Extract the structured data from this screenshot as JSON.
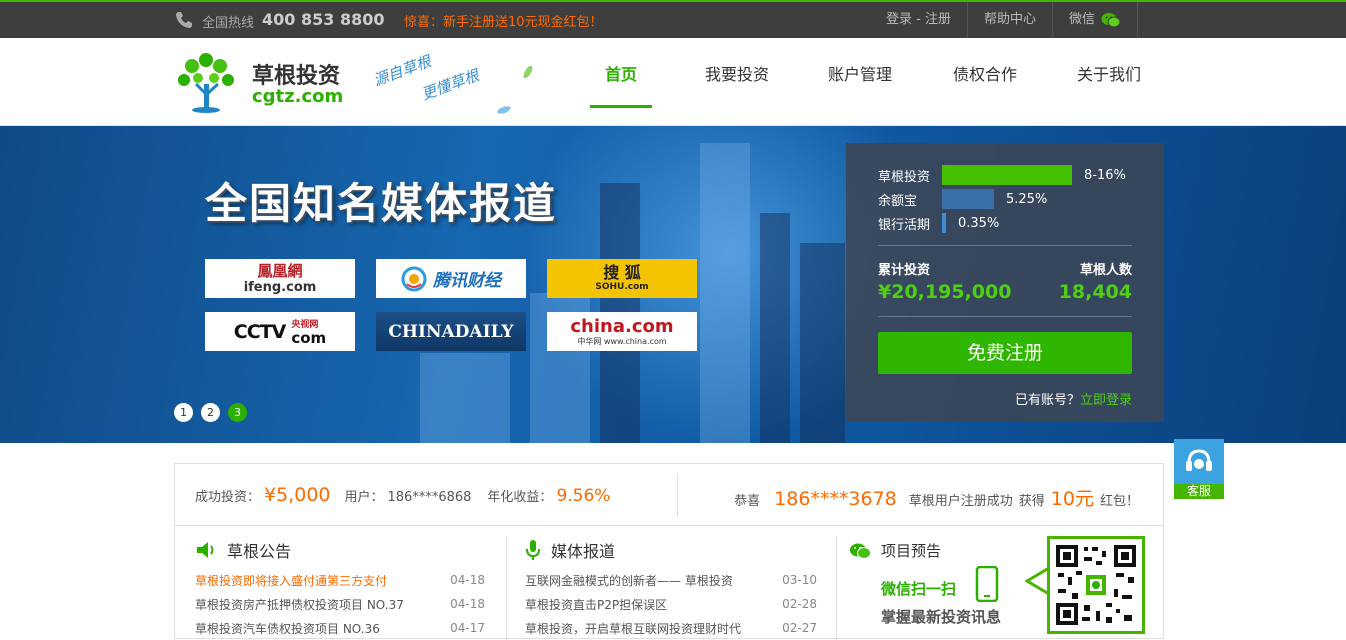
{
  "topbar": {
    "hotline_label": "全国热线",
    "hotline_number": "400 853 8800",
    "promo": "惊喜：新手注册送10元现金红包！",
    "login_register": "登录 - 注册",
    "help": "帮助中心",
    "wechat": "微信"
  },
  "header": {
    "logo_name": "草根投资",
    "logo_domain": "cgtz.com",
    "slogan_1": "源自草根",
    "slogan_2": "更懂草根",
    "nav": [
      "首页",
      "我要投资",
      "账户管理",
      "债权合作",
      "关于我们"
    ],
    "active_nav": "首页"
  },
  "banner": {
    "title": "全国知名媒体报道",
    "media": {
      "ifeng_cn": "鳳凰網",
      "ifeng_en": "ifeng.com",
      "tencent": "腾讯财经",
      "sohu_cn": "搜 狐",
      "sohu_en": "SOHU.com",
      "cctv": "CCTV",
      "cctv_cn": "央视网",
      "cctv_com": "com",
      "chinadaily": "CHINADAILY",
      "chinacom": "china.com",
      "chinacom_sub": "中华网 www.china.com"
    },
    "slides": [
      "1",
      "2",
      "3"
    ],
    "current_slide": "3"
  },
  "panel": {
    "rates": [
      {
        "label": "草根投资",
        "value": "8-16%",
        "fill": 0.51
      },
      {
        "label": "余额宝",
        "value": "5.25%",
        "fill": 0.2
      },
      {
        "label": "银行活期",
        "value": "0.35%",
        "fill": 0.02
      }
    ],
    "total_invest_label": "累计投资",
    "total_invest_value": "¥20,195,000",
    "users_label": "草根人数",
    "users_value": "18,404",
    "register_button": "免费注册",
    "has_account": "已有账号？",
    "login_link": "立即登录"
  },
  "service": {
    "label": "客服"
  },
  "ticker": {
    "invest_label": "成功投资：",
    "invest_amount": "¥5,000",
    "user_label": "用户：",
    "user_value": "186****6868",
    "rate_label": "年化收益：",
    "rate_value": "9.56%",
    "congrats": "恭喜",
    "phone": "186****3678",
    "reg_text": "草根用户注册成功",
    "got": "获得",
    "bonus": "10元",
    "bonus_suffix": "红包！"
  },
  "notices": {
    "title": "草根公告",
    "items": [
      {
        "text": "草根投资即将接入盛付通第三方支付",
        "date": "04-18"
      },
      {
        "text": "草根投资房产抵押债权投资项目 NO.37",
        "date": "04-18"
      },
      {
        "text": "草根投资汽车债权投资项目 NO.36",
        "date": "04-17"
      }
    ]
  },
  "media_reports": {
    "title": "媒体报道",
    "items": [
      {
        "text": "互联网金融模式的创新者—— 草根投资",
        "date": "03-10"
      },
      {
        "text": "草根投资直击P2P担保误区",
        "date": "02-28"
      },
      {
        "text": "草根投资，开启草根互联网投资理财时代",
        "date": "02-27"
      }
    ]
  },
  "preview": {
    "title": "项目预告",
    "scan": "微信扫一扫",
    "subtitle": "掌握最新投资讯息"
  },
  "colors": {
    "brand_green": "#2bb000",
    "accent_orange": "#ff6a00",
    "topbar": "#3e3e3e"
  }
}
